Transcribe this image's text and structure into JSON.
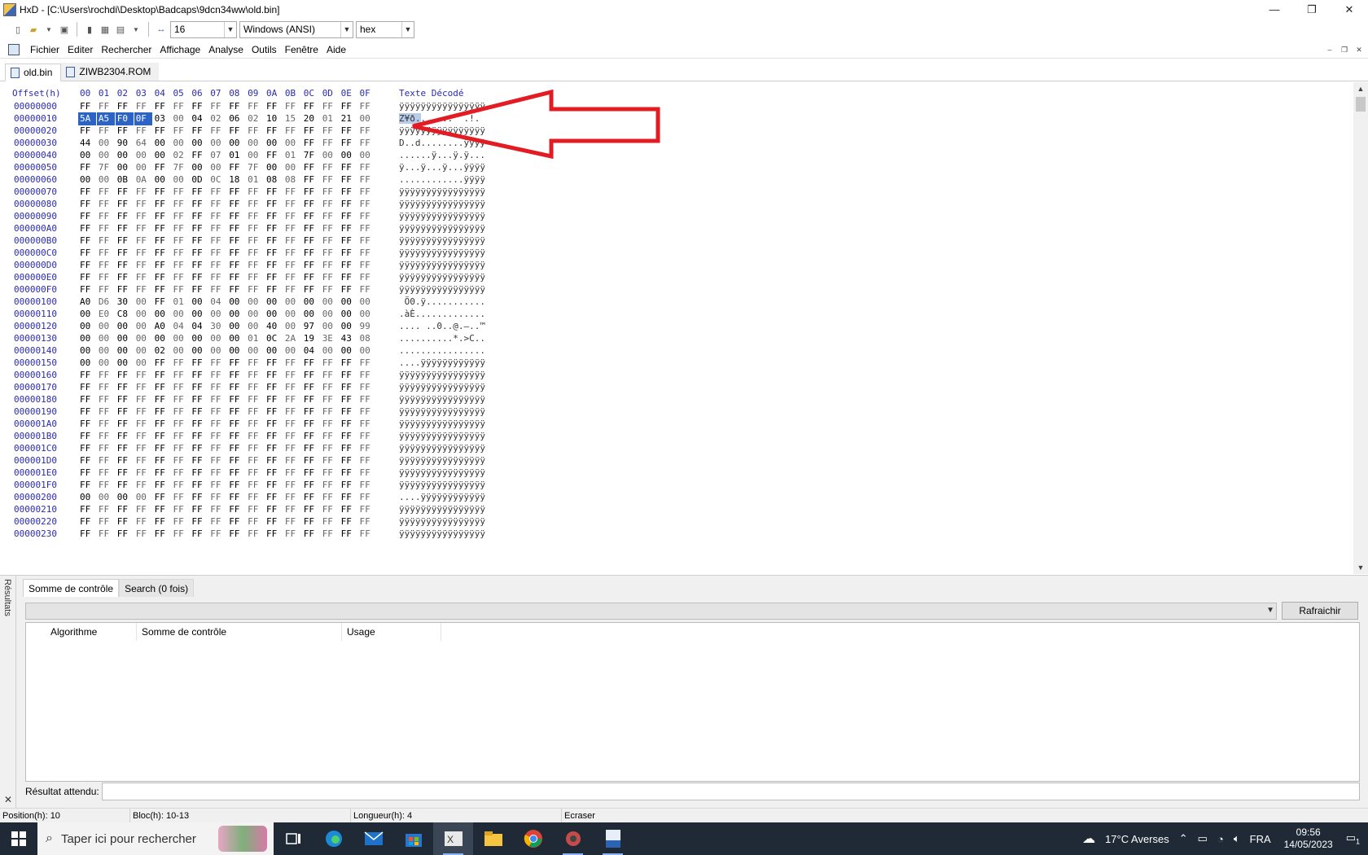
{
  "window": {
    "title": "HxD - [C:\\Users\\rochdi\\Desktop\\Badcaps\\9dcn34ww\\old.bin]",
    "controls": [
      "—",
      "❐",
      "✕"
    ]
  },
  "toolbar": {
    "bytes_per_row": "16",
    "charset": "Windows (ANSI)",
    "offset_base": "hex"
  },
  "menu": [
    "Fichier",
    "Editer",
    "Rechercher",
    "Affichage",
    "Analyse",
    "Outils",
    "Fenêtre",
    "Aide"
  ],
  "doc_tabs": [
    {
      "label": "old.bin",
      "active": true
    },
    {
      "label": "ZIWB2304.ROM",
      "active": false
    }
  ],
  "hex_header": {
    "offset_label": "Offset(h)",
    "columns": [
      "00",
      "01",
      "02",
      "03",
      "04",
      "05",
      "06",
      "07",
      "08",
      "09",
      "0A",
      "0B",
      "0C",
      "0D",
      "0E",
      "0F"
    ],
    "text_label": "Texte Décodé"
  },
  "hex_rows": [
    {
      "offset": "00000000",
      "bytes": "FF FF FF FF FF FF FF FF FF FF FF FF FF FF FF FF",
      "text": "ÿÿÿÿÿÿÿÿÿÿÿÿÿÿÿÿ"
    },
    {
      "offset": "00000010",
      "bytes": "5A A5 F0 0F 03 00 04 02 06 02 10 15 20 01 21 00",
      "text": "Z¥ð.......  .!."
    },
    {
      "offset": "00000020",
      "bytes": "FF FF FF FF FF FF FF FF FF FF FF FF FF FF FF FF",
      "text": "ÿÿÿÿÿÿÿÿÿÿÿÿÿÿÿÿ"
    },
    {
      "offset": "00000030",
      "bytes": "44 00 90 64 00 00 00 00 00 00 00 00 FF FF FF FF",
      "text": "D..d........ÿÿÿÿ"
    },
    {
      "offset": "00000040",
      "bytes": "00 00 00 00 00 02 FF 07 01 00 FF 01 7F 00 00 00",
      "text": "......ÿ...ÿ.ÿ..."
    },
    {
      "offset": "00000050",
      "bytes": "FF 7F 00 00 FF 7F 00 00 FF 7F 00 00 FF FF FF FF",
      "text": "ÿ...ÿ...ÿ...ÿÿÿÿ"
    },
    {
      "offset": "00000060",
      "bytes": "00 00 0B 0A 00 00 0D 0C 18 01 08 08 FF FF FF FF",
      "text": "............ÿÿÿÿ"
    },
    {
      "offset": "00000070",
      "bytes": "FF FF FF FF FF FF FF FF FF FF FF FF FF FF FF FF",
      "text": "ÿÿÿÿÿÿÿÿÿÿÿÿÿÿÿÿ"
    },
    {
      "offset": "00000080",
      "bytes": "FF FF FF FF FF FF FF FF FF FF FF FF FF FF FF FF",
      "text": "ÿÿÿÿÿÿÿÿÿÿÿÿÿÿÿÿ"
    },
    {
      "offset": "00000090",
      "bytes": "FF FF FF FF FF FF FF FF FF FF FF FF FF FF FF FF",
      "text": "ÿÿÿÿÿÿÿÿÿÿÿÿÿÿÿÿ"
    },
    {
      "offset": "000000A0",
      "bytes": "FF FF FF FF FF FF FF FF FF FF FF FF FF FF FF FF",
      "text": "ÿÿÿÿÿÿÿÿÿÿÿÿÿÿÿÿ"
    },
    {
      "offset": "000000B0",
      "bytes": "FF FF FF FF FF FF FF FF FF FF FF FF FF FF FF FF",
      "text": "ÿÿÿÿÿÿÿÿÿÿÿÿÿÿÿÿ"
    },
    {
      "offset": "000000C0",
      "bytes": "FF FF FF FF FF FF FF FF FF FF FF FF FF FF FF FF",
      "text": "ÿÿÿÿÿÿÿÿÿÿÿÿÿÿÿÿ"
    },
    {
      "offset": "000000D0",
      "bytes": "FF FF FF FF FF FF FF FF FF FF FF FF FF FF FF FF",
      "text": "ÿÿÿÿÿÿÿÿÿÿÿÿÿÿÿÿ"
    },
    {
      "offset": "000000E0",
      "bytes": "FF FF FF FF FF FF FF FF FF FF FF FF FF FF FF FF",
      "text": "ÿÿÿÿÿÿÿÿÿÿÿÿÿÿÿÿ"
    },
    {
      "offset": "000000F0",
      "bytes": "FF FF FF FF FF FF FF FF FF FF FF FF FF FF FF FF",
      "text": "ÿÿÿÿÿÿÿÿÿÿÿÿÿÿÿÿ"
    },
    {
      "offset": "00000100",
      "bytes": "A0 D6 30 00 FF 01 00 04 00 00 00 00 00 00 00 00",
      "text": " Ö0.ÿ..........."
    },
    {
      "offset": "00000110",
      "bytes": "00 E0 C8 00 00 00 00 00 00 00 00 00 00 00 00 00",
      "text": ".àÈ............."
    },
    {
      "offset": "00000120",
      "bytes": "00 00 00 00 A0 04 04 30 00 00 40 00 97 00 00 99",
      "text": ".... ..0..@.—..™"
    },
    {
      "offset": "00000130",
      "bytes": "00 00 00 00 00 00 00 00 00 01 0C 2A 19 3E 43 08 00",
      "text": "..........*.>C.."
    },
    {
      "offset": "00000140",
      "bytes": "00 00 00 00 02 00 00 00 00 00 00 00 04 00 00 00",
      "text": "................"
    },
    {
      "offset": "00000150",
      "bytes": "00 00 00 00 FF FF FF FF FF FF FF FF FF FF FF FF",
      "text": "....ÿÿÿÿÿÿÿÿÿÿÿÿ"
    },
    {
      "offset": "00000160",
      "bytes": "FF FF FF FF FF FF FF FF FF FF FF FF FF FF FF FF",
      "text": "ÿÿÿÿÿÿÿÿÿÿÿÿÿÿÿÿ"
    },
    {
      "offset": "00000170",
      "bytes": "FF FF FF FF FF FF FF FF FF FF FF FF FF FF FF FF",
      "text": "ÿÿÿÿÿÿÿÿÿÿÿÿÿÿÿÿ"
    },
    {
      "offset": "00000180",
      "bytes": "FF FF FF FF FF FF FF FF FF FF FF FF FF FF FF FF",
      "text": "ÿÿÿÿÿÿÿÿÿÿÿÿÿÿÿÿ"
    },
    {
      "offset": "00000190",
      "bytes": "FF FF FF FF FF FF FF FF FF FF FF FF FF FF FF FF",
      "text": "ÿÿÿÿÿÿÿÿÿÿÿÿÿÿÿÿ"
    },
    {
      "offset": "000001A0",
      "bytes": "FF FF FF FF FF FF FF FF FF FF FF FF FF FF FF FF",
      "text": "ÿÿÿÿÿÿÿÿÿÿÿÿÿÿÿÿ"
    },
    {
      "offset": "000001B0",
      "bytes": "FF FF FF FF FF FF FF FF FF FF FF FF FF FF FF FF",
      "text": "ÿÿÿÿÿÿÿÿÿÿÿÿÿÿÿÿ"
    },
    {
      "offset": "000001C0",
      "bytes": "FF FF FF FF FF FF FF FF FF FF FF FF FF FF FF FF",
      "text": "ÿÿÿÿÿÿÿÿÿÿÿÿÿÿÿÿ"
    },
    {
      "offset": "000001D0",
      "bytes": "FF FF FF FF FF FF FF FF FF FF FF FF FF FF FF FF",
      "text": "ÿÿÿÿÿÿÿÿÿÿÿÿÿÿÿÿ"
    },
    {
      "offset": "000001E0",
      "bytes": "FF FF FF FF FF FF FF FF FF FF FF FF FF FF FF FF",
      "text": "ÿÿÿÿÿÿÿÿÿÿÿÿÿÿÿÿ"
    },
    {
      "offset": "000001F0",
      "bytes": "FF FF FF FF FF FF FF FF FF FF FF FF FF FF FF FF",
      "text": "ÿÿÿÿÿÿÿÿÿÿÿÿÿÿÿÿ"
    },
    {
      "offset": "00000200",
      "bytes": "00 00 00 00 FF FF FF FF FF FF FF FF FF FF FF FF",
      "text": "....ÿÿÿÿÿÿÿÿÿÿÿÿ"
    },
    {
      "offset": "00000210",
      "bytes": "FF FF FF FF FF FF FF FF FF FF FF FF FF FF FF FF",
      "text": "ÿÿÿÿÿÿÿÿÿÿÿÿÿÿÿÿ"
    },
    {
      "offset": "00000220",
      "bytes": "FF FF FF FF FF FF FF FF FF FF FF FF FF FF FF FF",
      "text": "ÿÿÿÿÿÿÿÿÿÿÿÿÿÿÿÿ"
    },
    {
      "offset": "00000230",
      "bytes": "FF FF FF FF FF FF FF FF FF FF FF FF FF FF FF FF",
      "text": "ÿÿÿÿÿÿÿÿÿÿÿÿÿÿÿÿ"
    }
  ],
  "selection": {
    "row": 1,
    "byte_count": 4,
    "text_selected": "Z¥ð."
  },
  "annotation_color": "#e31b23",
  "results": {
    "side_label": "Résultats",
    "close": "✕",
    "tabs": [
      {
        "label": "Somme de contrôle",
        "active": true
      },
      {
        "label": "Search (0 fois)",
        "active": false
      }
    ],
    "refresh_label": "Rafraichir",
    "columns": [
      "Algorithme",
      "Somme de contrôle",
      "Usage"
    ],
    "expected_label": "Résultat attendu:",
    "expected_value": ""
  },
  "status": {
    "position": "Position(h): 10",
    "block": "Bloc(h): 10-13",
    "length": "Longueur(h): 4",
    "mode": "Ecraser"
  },
  "taskbar": {
    "search_placeholder": "Taper ici pour rechercher",
    "weather": "17°C  Averses",
    "language": "FRA",
    "time": "09:56",
    "date": "14/05/2023",
    "notification_count": "1",
    "apps": [
      "task-view-icon",
      "edge-icon",
      "mail-icon",
      "store-icon",
      "hxd-icon",
      "explorer-icon",
      "chrome-icon",
      "tool-icon",
      "pdf-icon"
    ]
  }
}
